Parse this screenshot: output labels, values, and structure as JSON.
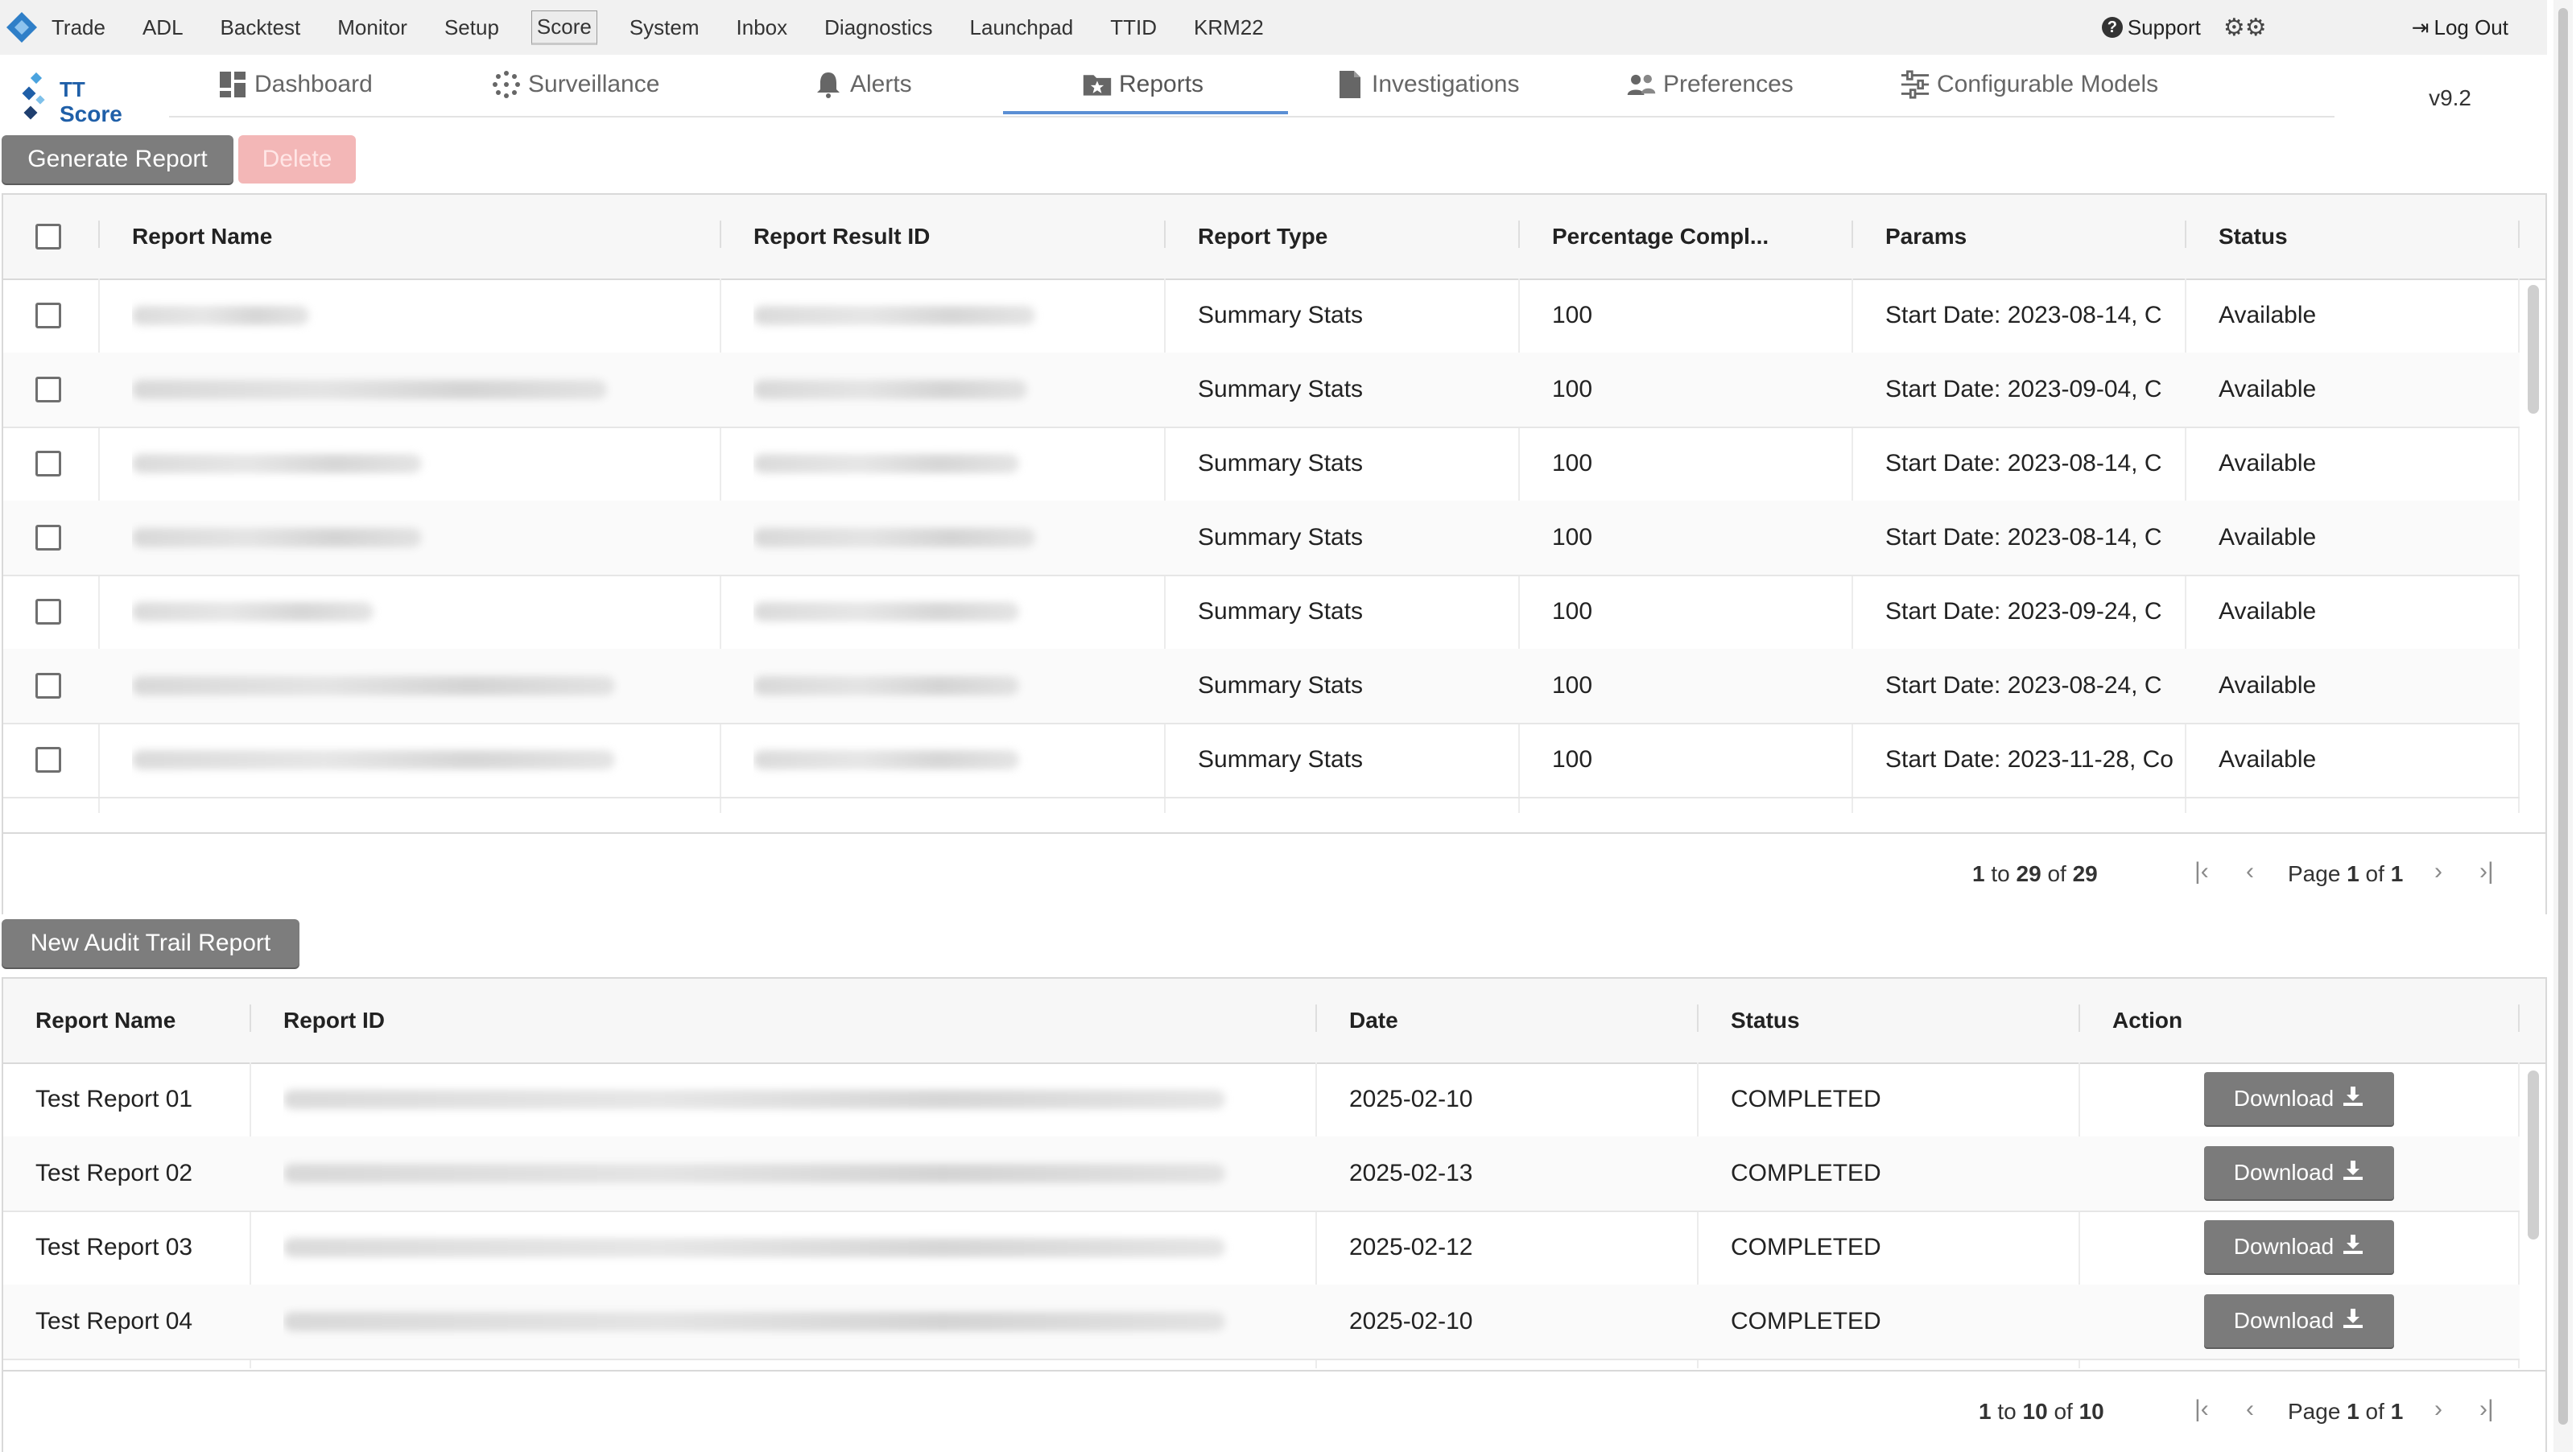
{
  "menubar": {
    "items": [
      "Trade",
      "ADL",
      "Backtest",
      "Monitor",
      "Setup",
      "Score",
      "System",
      "Inbox",
      "Diagnostics",
      "Launchpad",
      "TTID",
      "KRM22"
    ],
    "active": "Score",
    "support": "Support",
    "logout": "Log Out"
  },
  "brand": {
    "line1": "TT",
    "line2": "Score"
  },
  "tabs": [
    {
      "label": "Dashboard",
      "icon": "dashboard-icon"
    },
    {
      "label": "Surveillance",
      "icon": "surveillance-icon"
    },
    {
      "label": "Alerts",
      "icon": "bell-icon"
    },
    {
      "label": "Reports",
      "icon": "report-icon"
    },
    {
      "label": "Investigations",
      "icon": "document-icon"
    },
    {
      "label": "Preferences",
      "icon": "users-icon"
    },
    {
      "label": "Configurable Models",
      "icon": "sliders-icon"
    }
  ],
  "active_tab": "Reports",
  "version": "v9.2",
  "reports_toolbar": {
    "generate": "Generate Report",
    "delete": "Delete"
  },
  "reports_table": {
    "headers": [
      "Report Name",
      "Report Result ID",
      "Report Type",
      "Percentage Compl...",
      "Params",
      "Status"
    ],
    "rows": [
      {
        "type": "Summary Stats",
        "pct": "100",
        "params": "Start Date: 2023-08-14, C",
        "status": "Available"
      },
      {
        "type": "Summary Stats",
        "pct": "100",
        "params": "Start Date: 2023-09-04, C",
        "status": "Available"
      },
      {
        "type": "Summary Stats",
        "pct": "100",
        "params": "Start Date: 2023-08-14, C",
        "status": "Available"
      },
      {
        "type": "Summary Stats",
        "pct": "100",
        "params": "Start Date: 2023-08-14, C",
        "status": "Available"
      },
      {
        "type": "Summary Stats",
        "pct": "100",
        "params": "Start Date: 2023-09-24, C",
        "status": "Available"
      },
      {
        "type": "Summary Stats",
        "pct": "100",
        "params": "Start Date: 2023-08-24, C",
        "status": "Available"
      },
      {
        "type": "Summary Stats",
        "pct": "100",
        "params": "Start Date: 2023-11-28, Co",
        "status": "Available"
      }
    ],
    "pager": {
      "from": "1",
      "to": "29",
      "total": "29",
      "page": "1",
      "pages": "1"
    }
  },
  "audit_toolbar": {
    "new": "New Audit Trail Report"
  },
  "audit_table": {
    "headers": [
      "Report Name",
      "Report ID",
      "Date",
      "Status",
      "Action"
    ],
    "rows": [
      {
        "name": "Test Report 01",
        "date": "2025-02-10",
        "status": "COMPLETED",
        "action": "Download"
      },
      {
        "name": "Test Report 02",
        "date": "2025-02-13",
        "status": "COMPLETED",
        "action": "Download"
      },
      {
        "name": "Test Report 03",
        "date": "2025-02-12",
        "status": "COMPLETED",
        "action": "Download"
      },
      {
        "name": "Test Report 04",
        "date": "2025-02-10",
        "status": "COMPLETED",
        "action": "Download"
      }
    ],
    "pager": {
      "from": "1",
      "to": "10",
      "total": "10",
      "page": "1",
      "pages": "1"
    }
  },
  "pager_words": {
    "to": "to",
    "of": "of",
    "page": "Page"
  },
  "colors": {
    "accent": "#5b8fd4",
    "brand": "#1f5fa8",
    "button": "#7d7d7d",
    "delete": "#f3b7b7"
  }
}
